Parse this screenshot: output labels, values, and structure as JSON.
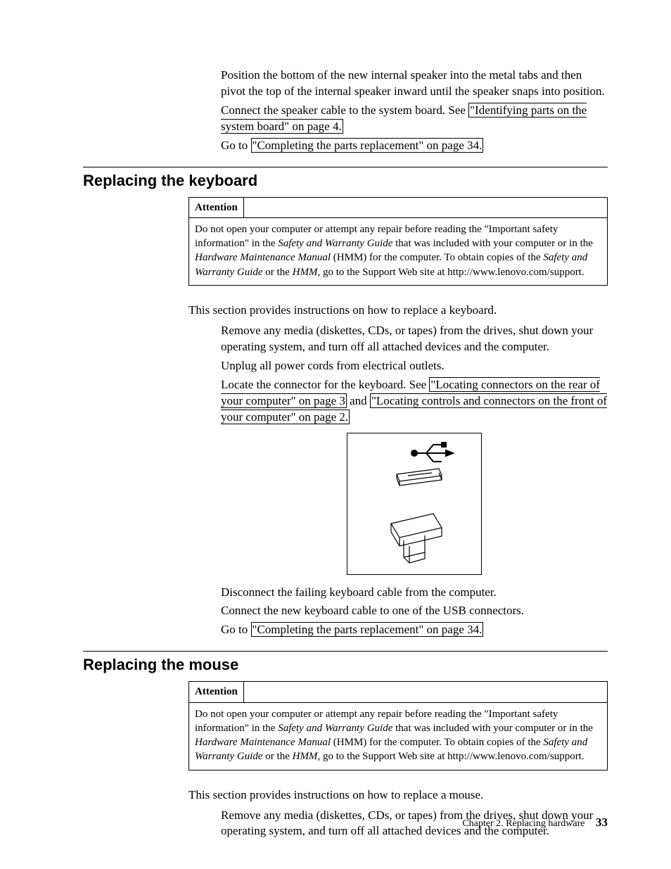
{
  "intro_steps": {
    "s1": "Position the bottom of the new internal speaker into the metal tabs and then pivot the top of the internal speaker inward until the speaker snaps into position.",
    "s2_a": "Connect the speaker cable to the system board. See ",
    "s2_link": "\"Identifying parts on the system board\" on page 4.",
    "s3_a": "Go to ",
    "s3_link": "\"Completing the parts replacement\" on page 34."
  },
  "keyboard": {
    "heading": "Replacing the keyboard",
    "attention_label": "Attention",
    "attention_1": "Do not open your computer or attempt any repair before reading the \"Important safety information\" in the ",
    "attention_i1": "Safety and Warranty Guide",
    "attention_2": " that was included with your computer or in the ",
    "attention_i2": "Hardware Maintenance Manual",
    "attention_3": " (HMM) for the computer. To obtain copies of the ",
    "attention_i3": "Safety and Warranty Guide",
    "attention_4": " or the ",
    "attention_i4": "HMM",
    "attention_5": ", go to the Support Web site at http://www.lenovo.com/support.",
    "intro": "This section provides instructions on how to replace a keyboard.",
    "step1": "Remove any media (diskettes, CDs, or tapes) from the drives, shut down your operating system, and turn off all attached devices and the computer.",
    "step2": "Unplug all power cords from electrical outlets.",
    "step3_a": "Locate the connector for the keyboard. See ",
    "step3_link1": "\"Locating connectors on the rear of your computer\" on page 3",
    "step3_mid": " and ",
    "step3_link2": "\"Locating controls and connectors on the front of your computer\" on page 2.",
    "step4": "Disconnect the failing keyboard cable from the computer.",
    "step5": "Connect the new keyboard cable to one of the USB connectors.",
    "step6_a": "Go to ",
    "step6_link": "\"Completing the parts replacement\" on page 34."
  },
  "mouse": {
    "heading": "Replacing the mouse",
    "attention_label": "Attention",
    "attention_1": "Do not open your computer or attempt any repair before reading the \"Important safety information\" in the ",
    "attention_i1": "Safety and Warranty Guide",
    "attention_2": " that was included with your computer or in the ",
    "attention_i2": "Hardware Maintenance Manual",
    "attention_3": " (HMM) for the computer. To obtain copies of the ",
    "attention_i3": "Safety and Warranty Guide",
    "attention_4": " or the ",
    "attention_i4": "HMM",
    "attention_5": ", go to the Support Web site at http://www.lenovo.com/support.",
    "intro": "This section provides instructions on how to replace a mouse.",
    "step1": "Remove any media (diskettes, CDs, or tapes) from the drives, shut down your operating system, and turn off all attached devices and the computer."
  },
  "footer": {
    "chapter": "Chapter 2. Replacing hardware",
    "page": "33"
  }
}
